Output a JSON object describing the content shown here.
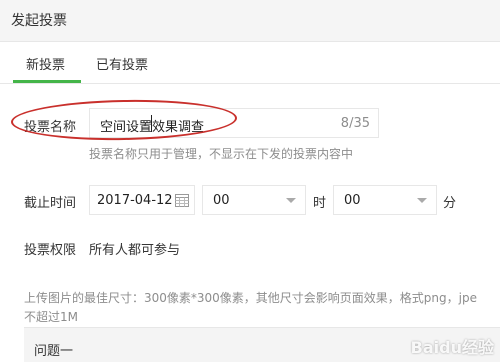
{
  "header": {
    "title": "发起投票"
  },
  "tabs": [
    {
      "label": "新投票"
    },
    {
      "label": "已有投票"
    }
  ],
  "vote_name": {
    "label": "投票名称",
    "value": "空间设置效果调查",
    "counter": "8/35",
    "hint": "投票名称只用于管理，不显示在下发的投票内容中"
  },
  "deadline": {
    "label": "截止时间",
    "date": "2017-04-12",
    "hour": "00",
    "hour_unit": "时",
    "minute": "00",
    "minute_unit": "分"
  },
  "permission": {
    "label": "投票权限",
    "value": "所有人都可参与"
  },
  "upload": {
    "hint_line1": "上传图片的最佳尺寸：300像素*300像素，其他尺寸会影响页面效果，格式png，jpe",
    "hint_line2": "不超过1M"
  },
  "question": {
    "label": "问题一"
  },
  "watermark": "Baidu经验",
  "colors": {
    "accent": "#44b549",
    "annotation": "#c9302c"
  },
  "icons": {
    "calendar": "calendar-icon",
    "dropdown": "chevron-down-icon"
  }
}
